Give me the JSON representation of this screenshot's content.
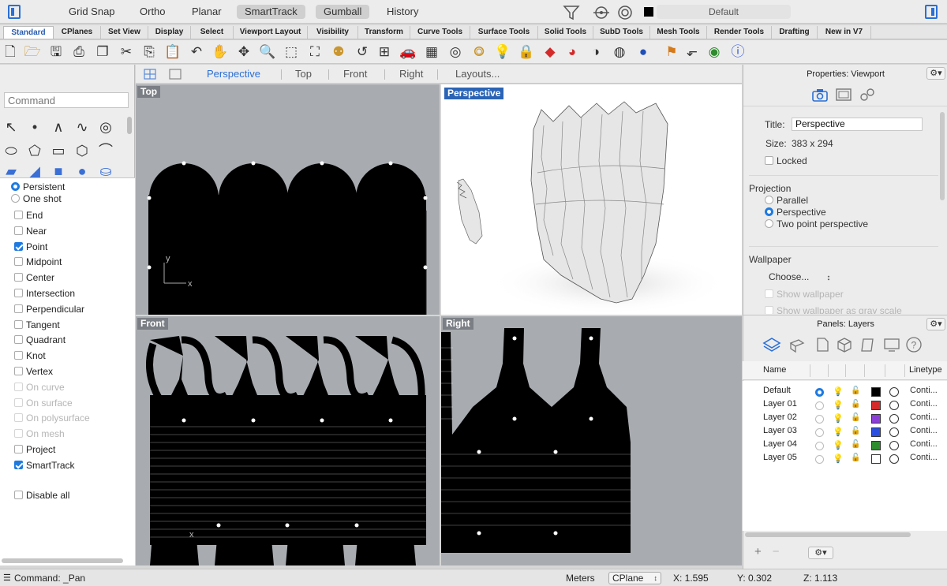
{
  "topbar": {
    "buttons": [
      {
        "label": "Grid Snap",
        "on": false
      },
      {
        "label": "Ortho",
        "on": false
      },
      {
        "label": "Planar",
        "on": false
      },
      {
        "label": "SmartTrack",
        "on": true
      },
      {
        "label": "Gumball",
        "on": true
      },
      {
        "label": "History",
        "on": false
      }
    ],
    "current_layer": "Default"
  },
  "tabs": [
    "Standard",
    "CPlanes",
    "Set View",
    "Display",
    "Select",
    "Viewport Layout",
    "Visibility",
    "Transform",
    "Curve Tools",
    "Surface Tools",
    "Solid Tools",
    "SubD Tools",
    "Mesh Tools",
    "Render Tools",
    "Drafting",
    "New in V7"
  ],
  "active_tab": "Standard",
  "command": {
    "placeholder": "Command"
  },
  "viewport_tabs": {
    "tabs": [
      "Perspective",
      "Top",
      "Front",
      "Right",
      "Layouts..."
    ],
    "active": "Perspective"
  },
  "viewports": {
    "top": "Top",
    "perspective": "Perspective",
    "front": "Front",
    "right": "Right"
  },
  "osnap": {
    "mode": [
      {
        "label": "Persistent",
        "on": true
      },
      {
        "label": "One shot",
        "on": false
      }
    ],
    "items": [
      {
        "label": "End",
        "checked": false,
        "disabled": false
      },
      {
        "label": "Near",
        "checked": false,
        "disabled": false
      },
      {
        "label": "Point",
        "checked": true,
        "disabled": false
      },
      {
        "label": "Midpoint",
        "checked": false,
        "disabled": false
      },
      {
        "label": "Center",
        "checked": false,
        "disabled": false
      },
      {
        "label": "Intersection",
        "checked": false,
        "disabled": false
      },
      {
        "label": "Perpendicular",
        "checked": false,
        "disabled": false
      },
      {
        "label": "Tangent",
        "checked": false,
        "disabled": false
      },
      {
        "label": "Quadrant",
        "checked": false,
        "disabled": false
      },
      {
        "label": "Knot",
        "checked": false,
        "disabled": false
      },
      {
        "label": "Vertex",
        "checked": false,
        "disabled": false
      },
      {
        "label": "On curve",
        "checked": false,
        "disabled": true
      },
      {
        "label": "On surface",
        "checked": false,
        "disabled": true
      },
      {
        "label": "On polysurface",
        "checked": false,
        "disabled": true
      },
      {
        "label": "On mesh",
        "checked": false,
        "disabled": true
      },
      {
        "label": "Project",
        "checked": false,
        "disabled": false
      },
      {
        "label": "SmartTrack",
        "checked": true,
        "disabled": false
      }
    ],
    "disable_all": "Disable all"
  },
  "properties": {
    "title": "Properties: Viewport",
    "title_label": "Title:",
    "title_value": "Perspective",
    "size_label": "Size:",
    "size_value": "383 x 294",
    "locked": "Locked",
    "projection_label": "Projection",
    "projection_options": [
      {
        "label": "Parallel",
        "on": false
      },
      {
        "label": "Perspective",
        "on": true
      },
      {
        "label": "Two point perspective",
        "on": false
      }
    ],
    "wallpaper_label": "Wallpaper",
    "wallpaper_choose": "Choose...",
    "show_wallpaper": "Show wallpaper",
    "show_wallpaper_gray": "Show wallpaper as gray scale"
  },
  "layers": {
    "title": "Panels: Layers",
    "col_name": "Name",
    "col_linetype": "Linetype",
    "rows": [
      {
        "name": "Default",
        "current": true,
        "color": "#000000",
        "linetype": "Conti..."
      },
      {
        "name": "Layer 01",
        "current": false,
        "color": "#d42a2a",
        "linetype": "Conti..."
      },
      {
        "name": "Layer 02",
        "current": false,
        "color": "#8b3fd6",
        "linetype": "Conti..."
      },
      {
        "name": "Layer 03",
        "current": false,
        "color": "#2a4fe0",
        "linetype": "Conti..."
      },
      {
        "name": "Layer 04",
        "current": false,
        "color": "#2e8b2e",
        "linetype": "Conti..."
      },
      {
        "name": "Layer 05",
        "current": false,
        "color": "#ffffff",
        "linetype": "Conti..."
      }
    ]
  },
  "status": {
    "command": "Command: _Pan",
    "units": "Meters",
    "cplane": "CPlane",
    "x": "X: 1.595",
    "y": "Y: 0.302",
    "z": "Z: 1.113"
  }
}
